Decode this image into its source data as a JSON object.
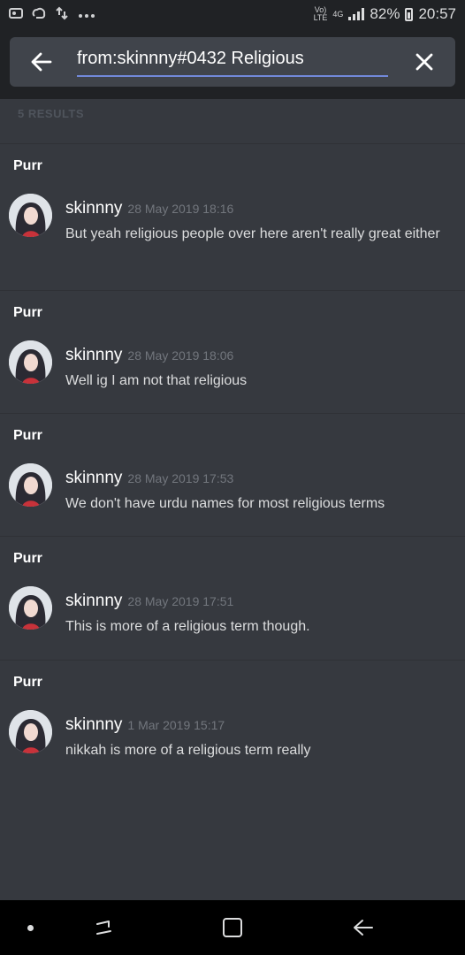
{
  "status_bar": {
    "left_icons": [
      "gallery-icon",
      "cloud-icon",
      "data-transfer-icon",
      "more-icon"
    ],
    "network_top": "Vo)",
    "network_bottom": "LTE",
    "network_type": "4G",
    "battery": "82%",
    "time": "20:57"
  },
  "search": {
    "query": "from:skinnny#0432 Religious",
    "back_icon": "arrow-left-icon",
    "clear_icon": "close-icon",
    "accent_color": "#7289da"
  },
  "results_count": "5 RESULTS",
  "results": [
    {
      "channel": "Purr",
      "author": "skinnny",
      "timestamp": "28 May 2019 18:16",
      "message": "But yeah religious people over here aren't really great either"
    },
    {
      "channel": "Purr",
      "author": "skinnny",
      "timestamp": "28 May 2019 18:06",
      "message": "Well ig I am not that religious"
    },
    {
      "channel": "Purr",
      "author": "skinnny",
      "timestamp": "28 May 2019 17:53",
      "message": "We don't have urdu names for most religious terms"
    },
    {
      "channel": "Purr",
      "author": "skinnny",
      "timestamp": "28 May 2019 17:51",
      "message": "This is more of a religious term though."
    },
    {
      "channel": "Purr",
      "author": "skinnny",
      "timestamp": "1 Mar 2019 15:17",
      "message": "nikkah is more of a religious term really"
    }
  ],
  "navbar": {
    "icons": [
      "dot-icon",
      "recents-icon",
      "home-icon",
      "back-icon"
    ]
  }
}
